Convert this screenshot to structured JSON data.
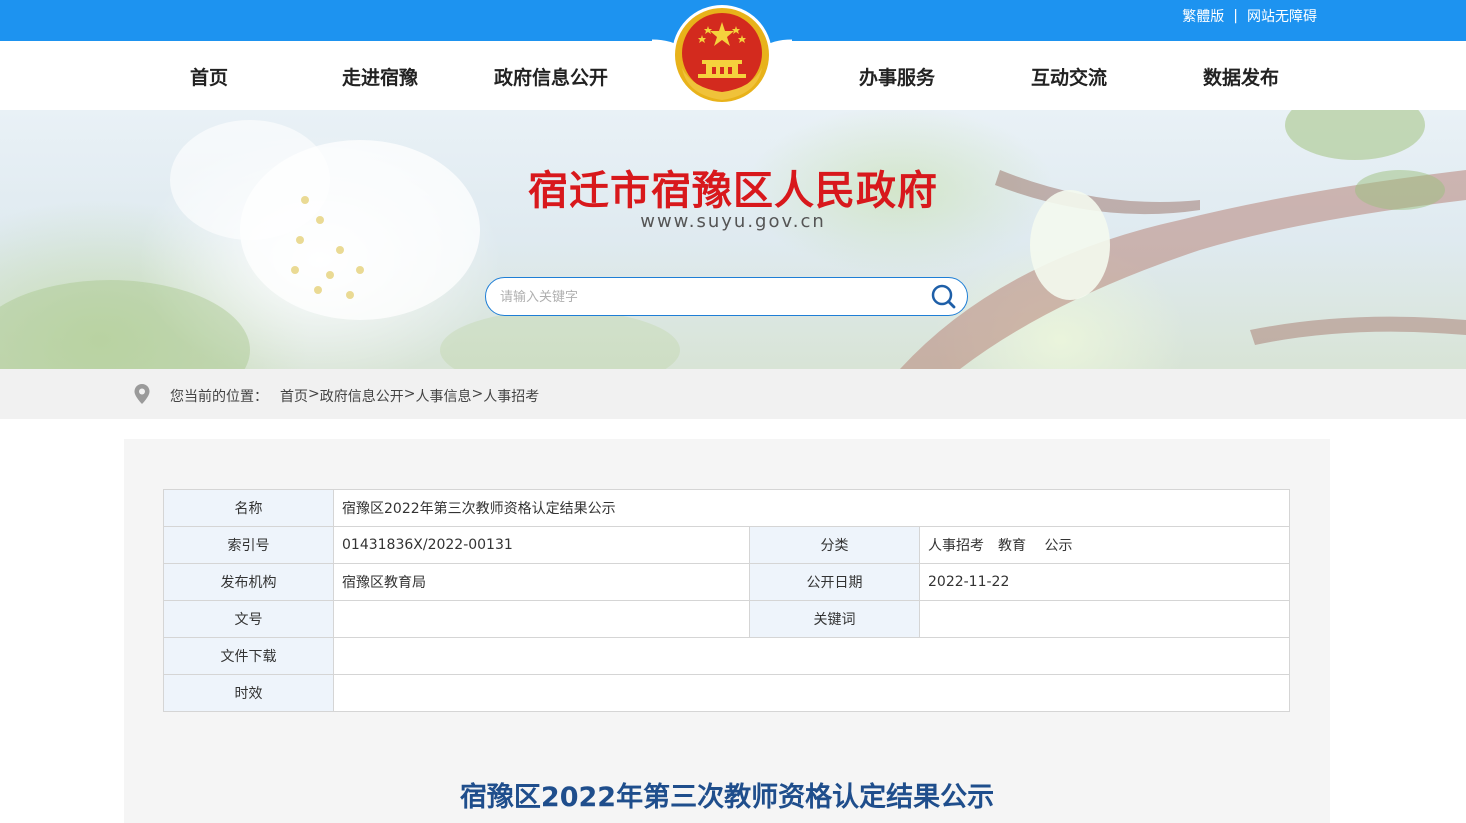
{
  "topbar": {
    "traditional": "繁體版",
    "separator": "|",
    "accessible": "网站无障碍"
  },
  "nav": {
    "items": [
      "首页",
      "走进宿豫",
      "政府信息公开",
      "办事服务",
      "互动交流",
      "数据发布"
    ]
  },
  "banner": {
    "title": "宿迁市宿豫区人民政府",
    "url": "www.suyu.gov.cn",
    "search_placeholder": "请输入关键字"
  },
  "breadcrumb": {
    "prefix": "您当前的位置：",
    "items": [
      "首页",
      "政府信息公开",
      "人事信息",
      "人事招考"
    ],
    "sep": ">"
  },
  "meta": {
    "name_label": "名称",
    "name_value": "宿豫区2022年第三次教师资格认定结果公示",
    "index_label": "索引号",
    "index_value": "01431836X/2022-00131",
    "category_label": "分类",
    "category_value": "人事招考　教育　 公示",
    "org_label": "发布机构",
    "org_value": "宿豫区教育局",
    "date_label": "公开日期",
    "date_value": "2022-11-22",
    "docno_label": "文号",
    "docno_value": "",
    "keywords_label": "关键词",
    "keywords_value": "",
    "download_label": "文件下载",
    "download_value": "",
    "validity_label": "时效",
    "validity_value": ""
  },
  "article": {
    "title": "宿豫区2022年第三次教师资格认定结果公示"
  },
  "colors": {
    "topbar": "#1d93f0",
    "title_red": "#d8181c",
    "article_blue": "#1f4e8c",
    "label_bg": "#eef4fb"
  },
  "icons": {
    "emblem": "national-emblem-icon",
    "search": "search-icon",
    "location": "location-pin-icon"
  }
}
